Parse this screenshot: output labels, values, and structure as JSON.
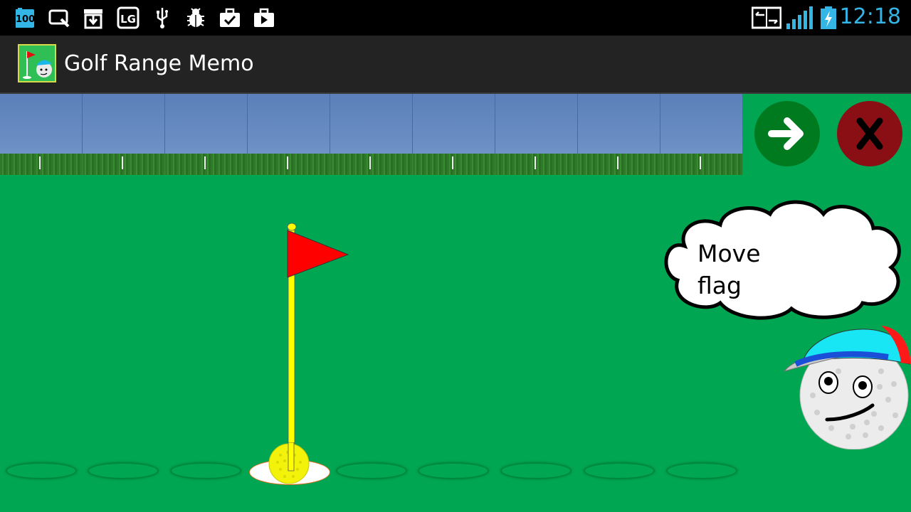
{
  "status_bar": {
    "battery_level": "100",
    "time": "12:18",
    "icons": [
      "battery-icon",
      "tablet-search-icon",
      "download-icon",
      "lg-icon",
      "usb-icon",
      "bug-icon",
      "briefcase-check-icon",
      "play-store-icon",
      "screen-mirror-icon",
      "signal-icon",
      "charging-icon"
    ],
    "accent_color": "#33b5e5"
  },
  "action_bar": {
    "title": "Golf Range Memo"
  },
  "toolbar": {
    "next_icon": "arrow-right-icon",
    "close_icon": "x-icon"
  },
  "range": {
    "tile_count": 9
  },
  "holes": {
    "count": 9,
    "active_index": 3
  },
  "speech": {
    "line1": "Move",
    "line2": "flag"
  },
  "colors": {
    "field": "#00a651",
    "next_button": "#007a1f",
    "close_button": "#8a0f14",
    "flag": "#ff0000",
    "pole": "#ffff00"
  }
}
